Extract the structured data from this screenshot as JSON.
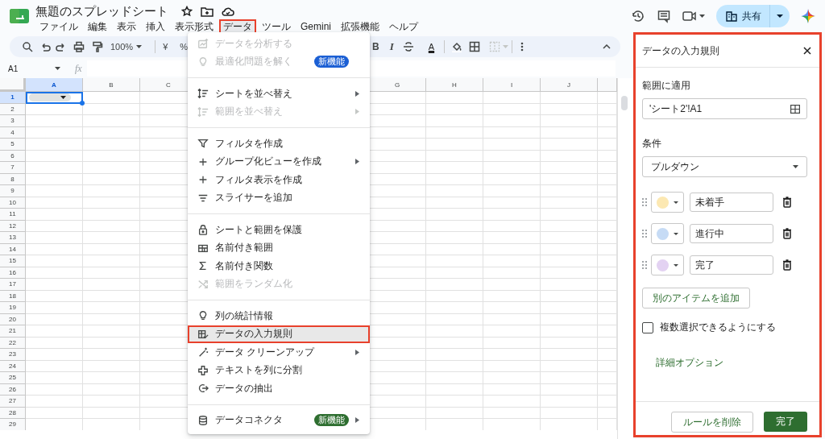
{
  "header": {
    "title": "無題のスプレッドシート",
    "menus": [
      {
        "label": "ファイル",
        "selected": false
      },
      {
        "label": "編集",
        "selected": false
      },
      {
        "label": "表示",
        "selected": false
      },
      {
        "label": "挿入",
        "selected": false
      },
      {
        "label": "表示形式",
        "selected": false
      },
      {
        "label": "データ",
        "selected": true
      },
      {
        "label": "ツール",
        "selected": false
      },
      {
        "label": "Gemini",
        "selected": false
      },
      {
        "label": "拡張機能",
        "selected": false
      },
      {
        "label": "ヘルプ",
        "selected": false
      }
    ],
    "share_button": {
      "label": "共有"
    }
  },
  "toolbar": {
    "zoom": "100%",
    "currency": "¥",
    "percent": "%",
    "bold": "B",
    "italic": "I",
    "text_color": "A"
  },
  "formula_bar": {
    "name_box": "A1",
    "fx": "fx"
  },
  "grid": {
    "columns": [
      {
        "label": "A",
        "selected": true
      },
      {
        "label": "B",
        "selected": false
      },
      {
        "label": "C",
        "selected": false
      },
      {
        "label": "G",
        "selected": false
      },
      {
        "label": "H",
        "selected": false
      },
      {
        "label": "I",
        "selected": false
      },
      {
        "label": "J",
        "selected": false
      }
    ],
    "rows": [
      {
        "label": "1",
        "selected": true
      },
      {
        "label": "2",
        "selected": false
      },
      {
        "label": "3",
        "selected": false
      },
      {
        "label": "4",
        "selected": false
      },
      {
        "label": "5",
        "selected": false
      },
      {
        "label": "6",
        "selected": false
      },
      {
        "label": "7",
        "selected": false
      },
      {
        "label": "8",
        "selected": false
      },
      {
        "label": "9",
        "selected": false
      },
      {
        "label": "10",
        "selected": false
      },
      {
        "label": "11",
        "selected": false
      },
      {
        "label": "12",
        "selected": false
      },
      {
        "label": "13",
        "selected": false
      },
      {
        "label": "14",
        "selected": false
      },
      {
        "label": "15",
        "selected": false
      },
      {
        "label": "16",
        "selected": false
      },
      {
        "label": "17",
        "selected": false
      },
      {
        "label": "18",
        "selected": false
      },
      {
        "label": "19",
        "selected": false
      },
      {
        "label": "20",
        "selected": false
      },
      {
        "label": "21",
        "selected": false
      },
      {
        "label": "22",
        "selected": false
      },
      {
        "label": "23",
        "selected": false
      },
      {
        "label": "24",
        "selected": false
      },
      {
        "label": "25",
        "selected": false
      },
      {
        "label": "26",
        "selected": false
      },
      {
        "label": "27",
        "selected": false
      },
      {
        "label": "28",
        "selected": false
      },
      {
        "label": "29",
        "selected": false
      }
    ],
    "dropdown_chip_in_cell": true
  },
  "menu": {
    "items": [
      {
        "kind": "item",
        "label": "データを分析する",
        "disabled": true,
        "submenu": false,
        "highlighted": false
      },
      {
        "kind": "item",
        "label": "最適化問題を解く",
        "disabled": true,
        "submenu": false,
        "highlighted": false,
        "badge": {
          "label": "新機能",
          "color": "#1b5fd4"
        }
      },
      {
        "kind": "separator"
      },
      {
        "kind": "item",
        "label": "シートを並べ替え",
        "disabled": false,
        "submenu": true,
        "highlighted": false
      },
      {
        "kind": "item",
        "label": "範囲を並べ替え",
        "disabled": true,
        "submenu": true,
        "highlighted": false
      },
      {
        "kind": "separator"
      },
      {
        "kind": "item",
        "label": "フィルタを作成",
        "disabled": false,
        "submenu": false,
        "highlighted": false
      },
      {
        "kind": "item",
        "label": "グループ化ビューを作成",
        "disabled": false,
        "submenu": true,
        "highlighted": false
      },
      {
        "kind": "item",
        "label": "フィルタ表示を作成",
        "disabled": false,
        "submenu": false,
        "highlighted": false
      },
      {
        "kind": "item",
        "label": "スライサーを追加",
        "disabled": false,
        "submenu": false,
        "highlighted": false
      },
      {
        "kind": "separator"
      },
      {
        "kind": "item",
        "label": "シートと範囲を保護",
        "disabled": false,
        "submenu": false,
        "highlighted": false
      },
      {
        "kind": "item",
        "label": "名前付き範囲",
        "disabled": false,
        "submenu": false,
        "highlighted": false
      },
      {
        "kind": "item",
        "label": "名前付き関数",
        "disabled": false,
        "submenu": false,
        "highlighted": false
      },
      {
        "kind": "item",
        "label": "範囲をランダム化",
        "disabled": true,
        "submenu": false,
        "highlighted": false
      },
      {
        "kind": "separator"
      },
      {
        "kind": "item",
        "label": "列の統計情報",
        "disabled": false,
        "submenu": false,
        "highlighted": false
      },
      {
        "kind": "item",
        "label": "データの入力規則",
        "disabled": false,
        "submenu": false,
        "highlighted": true
      },
      {
        "kind": "item",
        "label": "データ クリーンアップ",
        "disabled": false,
        "submenu": true,
        "highlighted": false
      },
      {
        "kind": "item",
        "label": "テキストを列に分割",
        "disabled": false,
        "submenu": false,
        "highlighted": false
      },
      {
        "kind": "item",
        "label": "データの抽出",
        "disabled": false,
        "submenu": false,
        "highlighted": false
      },
      {
        "kind": "separator"
      },
      {
        "kind": "item",
        "label": "データコネクタ",
        "disabled": false,
        "submenu": true,
        "highlighted": false,
        "badge": {
          "label": "新機能",
          "color": "#2e6e30"
        }
      }
    ]
  },
  "panel": {
    "title": "データの入力規則",
    "highlighted": true,
    "range_label": "範囲に適用",
    "range_value": "'シート2'!A1",
    "criteria_label": "条件",
    "criteria_value": "プルダウン",
    "items": [
      {
        "value": "未着手",
        "color": "#fce8b2"
      },
      {
        "value": "進行中",
        "color": "#c6dbf5"
      },
      {
        "value": "完了",
        "color": "#e3d2f2"
      }
    ],
    "add_button": "別のアイテムを追加",
    "multi_select": {
      "label": "複数選択できるようにする",
      "checked": false
    },
    "advanced_link": "詳細オプション",
    "remove_button": "ルールを削除",
    "done_button": "完了"
  }
}
